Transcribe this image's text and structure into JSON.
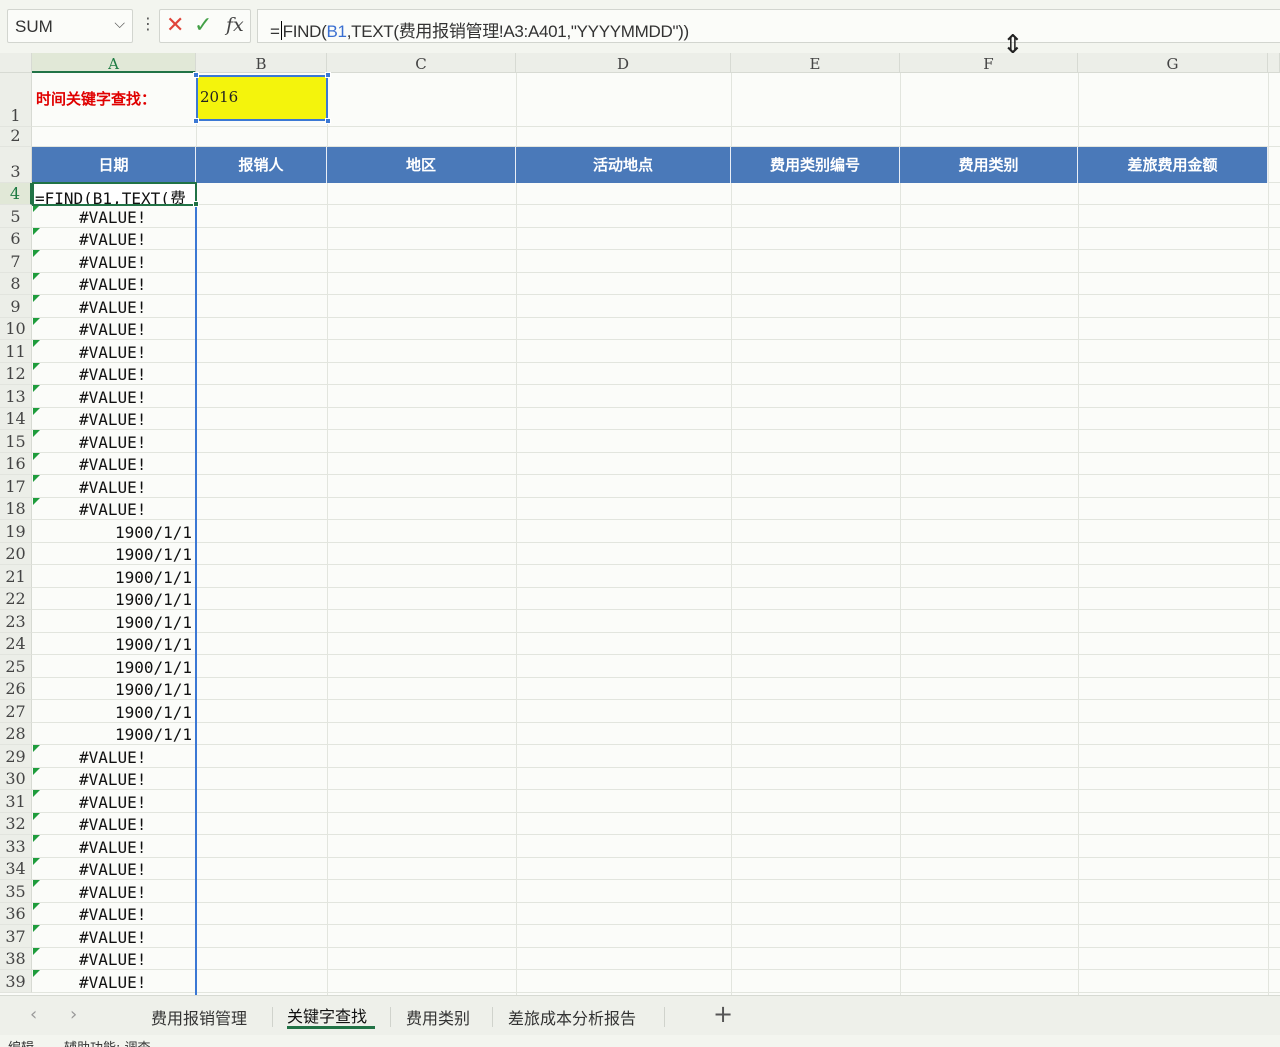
{
  "formula_bar": {
    "name_box": "SUM",
    "name_box_arrow": "⌵",
    "more_icon": "⋮",
    "cancel_icon": "✕",
    "confirm_icon": "✓",
    "fx_label": "fx",
    "formula_prefix": "=",
    "formula_f": "F",
    "formula_ind": "IND(",
    "formula_ref": "B1",
    "formula_rest": ",TEXT(费用报销管理!A3:A401,\"YYYYMMDD\"))",
    "cursor_icon": "⇕"
  },
  "columns": [
    "A",
    "B",
    "C",
    "D",
    "E",
    "F",
    "G"
  ],
  "cells": {
    "a1_label": "时间关键字查找：",
    "b1_value": "2016",
    "a4_editing": "=FIND(B1,TEXT(费"
  },
  "table_headers": [
    "日期",
    "报销人",
    "地区",
    "活动地点",
    "费用类别编号",
    "费用类别",
    "差旅费用金额"
  ],
  "rows": [
    {
      "n": "1"
    },
    {
      "n": "2"
    },
    {
      "n": "3"
    },
    {
      "n": "4"
    },
    {
      "n": "5",
      "v": "#VALUE!",
      "t": "err"
    },
    {
      "n": "6",
      "v": "#VALUE!",
      "t": "err"
    },
    {
      "n": "7",
      "v": "#VALUE!",
      "t": "err"
    },
    {
      "n": "8",
      "v": "#VALUE!",
      "t": "err"
    },
    {
      "n": "9",
      "v": "#VALUE!",
      "t": "err"
    },
    {
      "n": "10",
      "v": "#VALUE!",
      "t": "err"
    },
    {
      "n": "11",
      "v": "#VALUE!",
      "t": "err"
    },
    {
      "n": "12",
      "v": "#VALUE!",
      "t": "err"
    },
    {
      "n": "13",
      "v": "#VALUE!",
      "t": "err"
    },
    {
      "n": "14",
      "v": "#VALUE!",
      "t": "err"
    },
    {
      "n": "15",
      "v": "#VALUE!",
      "t": "err"
    },
    {
      "n": "16",
      "v": "#VALUE!",
      "t": "err"
    },
    {
      "n": "17",
      "v": "#VALUE!",
      "t": "err"
    },
    {
      "n": "18",
      "v": "#VALUE!",
      "t": "err"
    },
    {
      "n": "19",
      "v": "1900/1/1",
      "t": "date"
    },
    {
      "n": "20",
      "v": "1900/1/1",
      "t": "date"
    },
    {
      "n": "21",
      "v": "1900/1/1",
      "t": "date"
    },
    {
      "n": "22",
      "v": "1900/1/1",
      "t": "date"
    },
    {
      "n": "23",
      "v": "1900/1/1",
      "t": "date"
    },
    {
      "n": "24",
      "v": "1900/1/1",
      "t": "date"
    },
    {
      "n": "25",
      "v": "1900/1/1",
      "t": "date"
    },
    {
      "n": "26",
      "v": "1900/1/1",
      "t": "date"
    },
    {
      "n": "27",
      "v": "1900/1/1",
      "t": "date"
    },
    {
      "n": "28",
      "v": "1900/1/1",
      "t": "date"
    },
    {
      "n": "29",
      "v": "#VALUE!",
      "t": "err"
    },
    {
      "n": "30",
      "v": "#VALUE!",
      "t": "err"
    },
    {
      "n": "31",
      "v": "#VALUE!",
      "t": "err"
    },
    {
      "n": "32",
      "v": "#VALUE!",
      "t": "err"
    },
    {
      "n": "33",
      "v": "#VALUE!",
      "t": "err"
    },
    {
      "n": "34",
      "v": "#VALUE!",
      "t": "err"
    },
    {
      "n": "35",
      "v": "#VALUE!",
      "t": "err"
    },
    {
      "n": "36",
      "v": "#VALUE!",
      "t": "err"
    },
    {
      "n": "37",
      "v": "#VALUE!",
      "t": "err"
    },
    {
      "n": "38",
      "v": "#VALUE!",
      "t": "err"
    },
    {
      "n": "39",
      "v": "#VALUE!",
      "t": "err"
    }
  ],
  "sheet_tabs": {
    "prev_icon": "‹",
    "next_icon": "›",
    "tabs": [
      "费用报销管理",
      "关键字查找",
      "费用类别",
      "差旅成本分析报告"
    ],
    "active": "关键字查找",
    "add_icon": "+"
  },
  "status_bar": {
    "left": "编辑",
    "accessibility": "辅助功能: 调查"
  },
  "colors": {
    "header_blue": "#4a79b9",
    "input_yellow": "#f4f40c",
    "label_red": "#e00000",
    "selection_green": "#217346",
    "range_blue": "#3b78d4"
  }
}
